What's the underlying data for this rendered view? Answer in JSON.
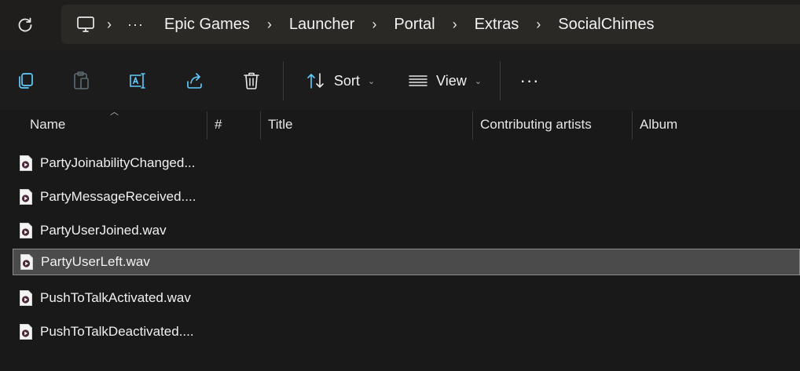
{
  "breadcrumb": {
    "items": [
      "Epic Games",
      "Launcher",
      "Portal",
      "Extras",
      "SocialChimes"
    ],
    "overflow": "···"
  },
  "toolbar": {
    "sort_label": "Sort",
    "view_label": "View",
    "more": "···"
  },
  "columns": [
    "Name",
    "#",
    "Title",
    "Contributing artists",
    "Album"
  ],
  "files": [
    {
      "name": "PartyJoinabilityChanged..."
    },
    {
      "name": "PartyMessageReceived...."
    },
    {
      "name": "PartyUserJoined.wav"
    },
    {
      "name": "PartyUserLeft.wav"
    },
    {
      "name": "PushToTalkActivated.wav"
    },
    {
      "name": "PushToTalkDeactivated...."
    }
  ],
  "selected_file": "PartyUserLeft.wav",
  "colors": {
    "background": "#191919",
    "selection": "#4b4b4b",
    "accent_icon": "#60cdff"
  }
}
